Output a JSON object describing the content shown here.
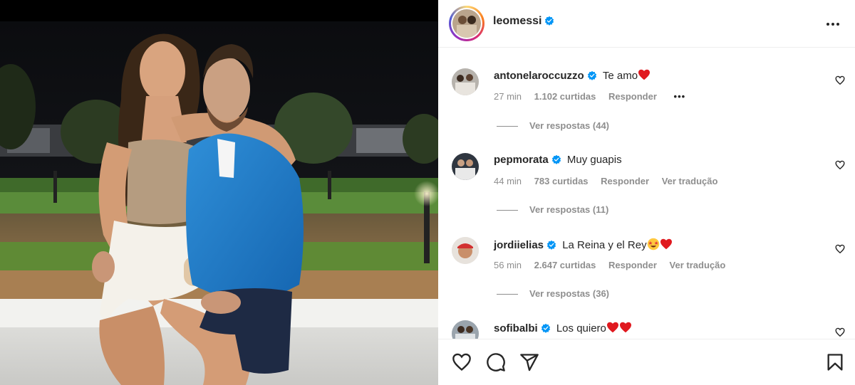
{
  "post": {
    "username": "leomessi",
    "verified": true,
    "more_icon": "more-horizontal-icon"
  },
  "comments": [
    {
      "username": "antonelaroccuzzo",
      "text": "Te amo",
      "emojis": [
        "red-heart"
      ],
      "time": "27 min",
      "likes": "1.102 curtidas",
      "reply": "Responder",
      "translate": "",
      "options": "•••",
      "view_replies": "Ver respostas (44)"
    },
    {
      "username": "pepmorata",
      "text": "Muy guapis",
      "emojis": [],
      "time": "44 min",
      "likes": "783 curtidas",
      "reply": "Responder",
      "translate": "Ver tradução",
      "options": "",
      "view_replies": "Ver respostas (11)"
    },
    {
      "username": "jordiielias",
      "text": "La Reina y el Rey",
      "emojis": [
        "star-struck",
        "red-heart"
      ],
      "time": "56 min",
      "likes": "2.647 curtidas",
      "reply": "Responder",
      "translate": "Ver tradução",
      "options": "",
      "view_replies": "Ver respostas (36)"
    },
    {
      "username": "sofibalbi",
      "text": "Los quiero",
      "emojis": [
        "red-heart",
        "red-heart"
      ],
      "time": "",
      "likes": "",
      "reply": "",
      "translate": "",
      "options": "",
      "view_replies": ""
    }
  ],
  "actions": {
    "like_icon": "heart-icon",
    "comment_icon": "comment-icon",
    "share_icon": "share-icon",
    "save_icon": "bookmark-icon"
  },
  "colors": {
    "verified": "#0095f6",
    "heart": "#ed4956",
    "meta_text": "#8e8e8e",
    "primary_text": "#262626"
  }
}
